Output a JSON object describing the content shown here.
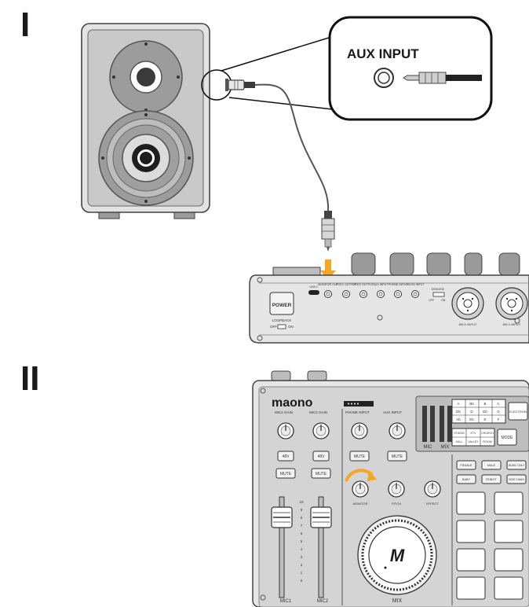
{
  "steps": {
    "one": "I",
    "two": "II"
  },
  "callout": {
    "title": "AUX INPUT"
  },
  "mixer_rear": {
    "ports": [
      "USB C",
      "MONITOR OUT",
      "POD1 OUTPUT",
      "POD2 OUTPUT",
      "AUX INPUT",
      "PHONE INPUT",
      "MIC/IN INPUT"
    ],
    "power_label": "POWER",
    "loopback_label": "LOOPBACK",
    "loopback_off": "OFF",
    "loopback_on": "ON",
    "denoise_label": "DENOISE",
    "denoise_off": "OFF",
    "denoise_on": "ON",
    "xlr_labels": [
      "MIC2 INPUT",
      "MIC1 INPUT"
    ]
  },
  "mixer_top": {
    "brand": "maono",
    "knob_labels": [
      "MIC1 GAIN",
      "MIC2 GAIN",
      "PHONE INPUT",
      "AUX INPUT"
    ],
    "btn_48v": [
      "48V",
      "48V"
    ],
    "btn_mute": [
      "MUTE",
      "MUTE",
      "MUTE",
      "MUTE"
    ],
    "knob2_labels": [
      "MONITOR",
      "PITCH",
      "EFFECT"
    ],
    "fader_scale": [
      "10",
      "9",
      "8",
      "7",
      "6",
      "5",
      "4",
      "3",
      "2",
      "1",
      "0"
    ],
    "fader_labels": [
      "MIC1",
      "MIC2"
    ],
    "mix_label": "MIX",
    "meter_labels": [
      "MIC",
      "MIX"
    ],
    "key_grid": [
      "A",
      "Bb",
      "B",
      "C",
      "Db",
      "D",
      "Eb",
      "G",
      "Ab",
      "Eb",
      "E",
      "F"
    ],
    "electron": "ELECTRON",
    "scene_grid": [
      "STUDIO",
      "KTV",
      "CHURCH",
      "HALL",
      "VALLEY",
      "ROOM"
    ],
    "mode": "MODE",
    "voice_buttons": [
      "FEMALE",
      "MALE",
      "MUSIC ONLY",
      "BABY",
      "ROBOT",
      "SIDE CHAIN"
    ]
  },
  "colors": {
    "arrow": "#f5a623",
    "panel": "#d4d4d4",
    "body": "#e6e6e6",
    "speaker": "#cfcfcf"
  }
}
